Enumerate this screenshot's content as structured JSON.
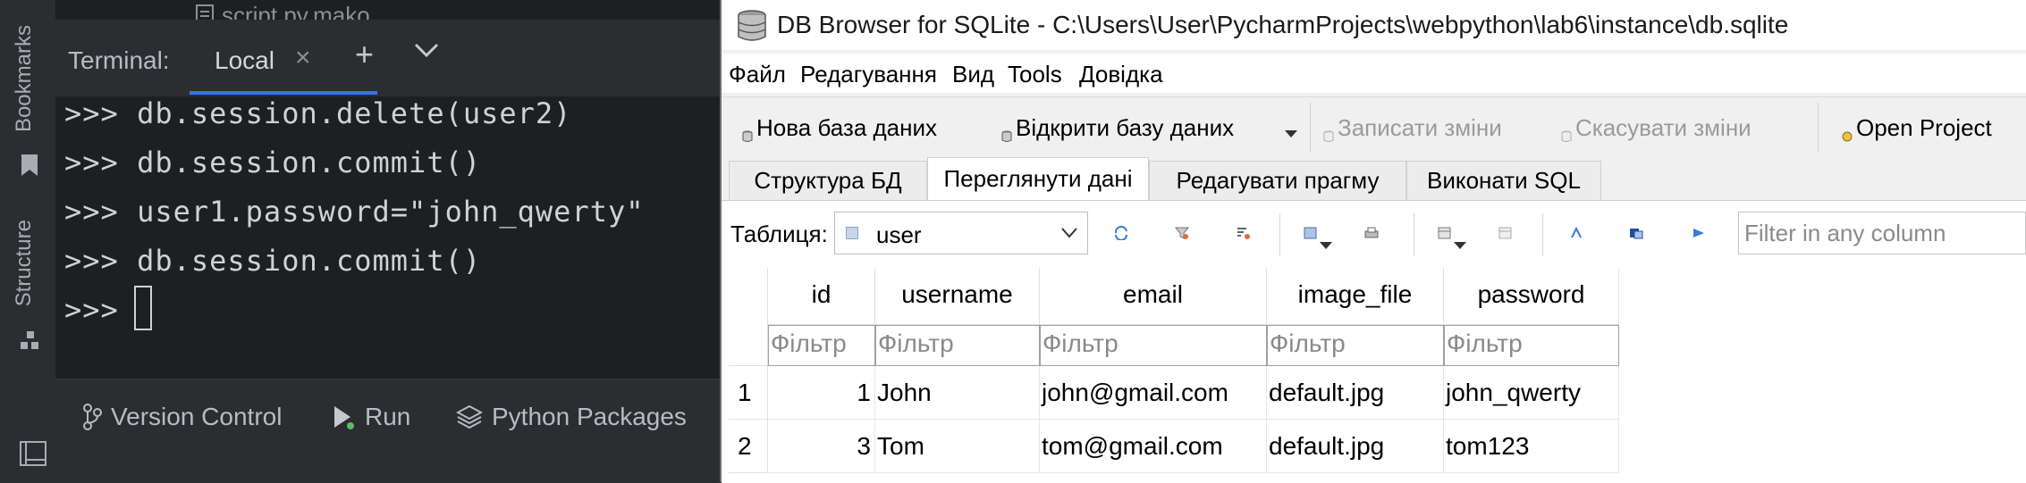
{
  "ide": {
    "side_labels": {
      "bookmarks": "Bookmarks",
      "structure": "Structure"
    },
    "top_file": "script.py.mako",
    "terminal": {
      "label": "Terminal:",
      "tab_label": "Local",
      "tab_close": "×",
      "add": "+",
      "lines": [
        ">>> db.session.delete(user2)",
        ">>> db.session.commit()",
        ">>> user1.password=\"john_qwerty\"",
        ">>> db.session.commit()",
        ">>> "
      ]
    },
    "bottom": {
      "version_control": "Version Control",
      "run": "Run",
      "python_packages": "Python Packages"
    }
  },
  "dbb": {
    "title": "DB Browser for SQLite - C:\\Users\\User\\PycharmProjects\\webpython\\lab6\\instance\\db.sqlite",
    "menu": [
      "Файл",
      "Редагування",
      "Вид",
      "Tools",
      "Довідка"
    ],
    "toolbar": {
      "new_db": "Нова база даних",
      "open_db": "Відкрити базу даних",
      "write_changes": "Записати зміни",
      "revert_changes": "Скасувати зміни",
      "open_project": "Open Project"
    },
    "tabs": [
      "Структура БД",
      "Переглянути дані",
      "Редагувати прагму",
      "Виконати SQL"
    ],
    "active_tab": "Переглянути дані",
    "browse": {
      "table_label": "Таблиця:",
      "table_value": "user",
      "filter_placeholder": "Filter in any column",
      "columns": [
        "id",
        "username",
        "email",
        "image_file",
        "password"
      ],
      "filter_text": "Фільтр",
      "rows": [
        {
          "rownum": "1",
          "id": "1",
          "username": "John",
          "email": "john@gmail.com",
          "image_file": "default.jpg",
          "password": "john_qwerty"
        },
        {
          "rownum": "2",
          "id": "3",
          "username": "Tom",
          "email": "tom@gmail.com",
          "image_file": "default.jpg",
          "password": "tom123"
        }
      ]
    }
  },
  "colors": {
    "ide_bg": "#1e1f22",
    "ide_panel": "#2b2d30",
    "accent": "#3574f0",
    "run_dot": "#5fb865"
  }
}
